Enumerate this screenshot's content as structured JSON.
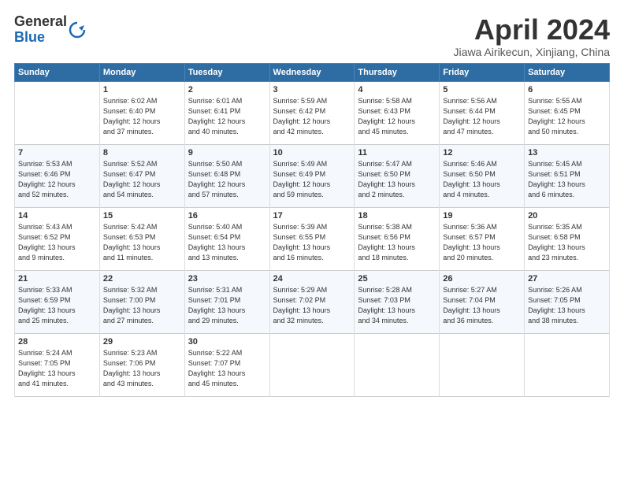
{
  "logo": {
    "general": "General",
    "blue": "Blue"
  },
  "title": "April 2024",
  "location": "Jiawa Airikecun, Xinjiang, China",
  "days_of_week": [
    "Sunday",
    "Monday",
    "Tuesday",
    "Wednesday",
    "Thursday",
    "Friday",
    "Saturday"
  ],
  "weeks": [
    [
      {
        "day": "",
        "content": ""
      },
      {
        "day": "1",
        "content": "Sunrise: 6:02 AM\nSunset: 6:40 PM\nDaylight: 12 hours\nand 37 minutes."
      },
      {
        "day": "2",
        "content": "Sunrise: 6:01 AM\nSunset: 6:41 PM\nDaylight: 12 hours\nand 40 minutes."
      },
      {
        "day": "3",
        "content": "Sunrise: 5:59 AM\nSunset: 6:42 PM\nDaylight: 12 hours\nand 42 minutes."
      },
      {
        "day": "4",
        "content": "Sunrise: 5:58 AM\nSunset: 6:43 PM\nDaylight: 12 hours\nand 45 minutes."
      },
      {
        "day": "5",
        "content": "Sunrise: 5:56 AM\nSunset: 6:44 PM\nDaylight: 12 hours\nand 47 minutes."
      },
      {
        "day": "6",
        "content": "Sunrise: 5:55 AM\nSunset: 6:45 PM\nDaylight: 12 hours\nand 50 minutes."
      }
    ],
    [
      {
        "day": "7",
        "content": "Sunrise: 5:53 AM\nSunset: 6:46 PM\nDaylight: 12 hours\nand 52 minutes."
      },
      {
        "day": "8",
        "content": "Sunrise: 5:52 AM\nSunset: 6:47 PM\nDaylight: 12 hours\nand 54 minutes."
      },
      {
        "day": "9",
        "content": "Sunrise: 5:50 AM\nSunset: 6:48 PM\nDaylight: 12 hours\nand 57 minutes."
      },
      {
        "day": "10",
        "content": "Sunrise: 5:49 AM\nSunset: 6:49 PM\nDaylight: 12 hours\nand 59 minutes."
      },
      {
        "day": "11",
        "content": "Sunrise: 5:47 AM\nSunset: 6:50 PM\nDaylight: 13 hours\nand 2 minutes."
      },
      {
        "day": "12",
        "content": "Sunrise: 5:46 AM\nSunset: 6:50 PM\nDaylight: 13 hours\nand 4 minutes."
      },
      {
        "day": "13",
        "content": "Sunrise: 5:45 AM\nSunset: 6:51 PM\nDaylight: 13 hours\nand 6 minutes."
      }
    ],
    [
      {
        "day": "14",
        "content": "Sunrise: 5:43 AM\nSunset: 6:52 PM\nDaylight: 13 hours\nand 9 minutes."
      },
      {
        "day": "15",
        "content": "Sunrise: 5:42 AM\nSunset: 6:53 PM\nDaylight: 13 hours\nand 11 minutes."
      },
      {
        "day": "16",
        "content": "Sunrise: 5:40 AM\nSunset: 6:54 PM\nDaylight: 13 hours\nand 13 minutes."
      },
      {
        "day": "17",
        "content": "Sunrise: 5:39 AM\nSunset: 6:55 PM\nDaylight: 13 hours\nand 16 minutes."
      },
      {
        "day": "18",
        "content": "Sunrise: 5:38 AM\nSunset: 6:56 PM\nDaylight: 13 hours\nand 18 minutes."
      },
      {
        "day": "19",
        "content": "Sunrise: 5:36 AM\nSunset: 6:57 PM\nDaylight: 13 hours\nand 20 minutes."
      },
      {
        "day": "20",
        "content": "Sunrise: 5:35 AM\nSunset: 6:58 PM\nDaylight: 13 hours\nand 23 minutes."
      }
    ],
    [
      {
        "day": "21",
        "content": "Sunrise: 5:33 AM\nSunset: 6:59 PM\nDaylight: 13 hours\nand 25 minutes."
      },
      {
        "day": "22",
        "content": "Sunrise: 5:32 AM\nSunset: 7:00 PM\nDaylight: 13 hours\nand 27 minutes."
      },
      {
        "day": "23",
        "content": "Sunrise: 5:31 AM\nSunset: 7:01 PM\nDaylight: 13 hours\nand 29 minutes."
      },
      {
        "day": "24",
        "content": "Sunrise: 5:29 AM\nSunset: 7:02 PM\nDaylight: 13 hours\nand 32 minutes."
      },
      {
        "day": "25",
        "content": "Sunrise: 5:28 AM\nSunset: 7:03 PM\nDaylight: 13 hours\nand 34 minutes."
      },
      {
        "day": "26",
        "content": "Sunrise: 5:27 AM\nSunset: 7:04 PM\nDaylight: 13 hours\nand 36 minutes."
      },
      {
        "day": "27",
        "content": "Sunrise: 5:26 AM\nSunset: 7:05 PM\nDaylight: 13 hours\nand 38 minutes."
      }
    ],
    [
      {
        "day": "28",
        "content": "Sunrise: 5:24 AM\nSunset: 7:05 PM\nDaylight: 13 hours\nand 41 minutes."
      },
      {
        "day": "29",
        "content": "Sunrise: 5:23 AM\nSunset: 7:06 PM\nDaylight: 13 hours\nand 43 minutes."
      },
      {
        "day": "30",
        "content": "Sunrise: 5:22 AM\nSunset: 7:07 PM\nDaylight: 13 hours\nand 45 minutes."
      },
      {
        "day": "",
        "content": ""
      },
      {
        "day": "",
        "content": ""
      },
      {
        "day": "",
        "content": ""
      },
      {
        "day": "",
        "content": ""
      }
    ]
  ]
}
